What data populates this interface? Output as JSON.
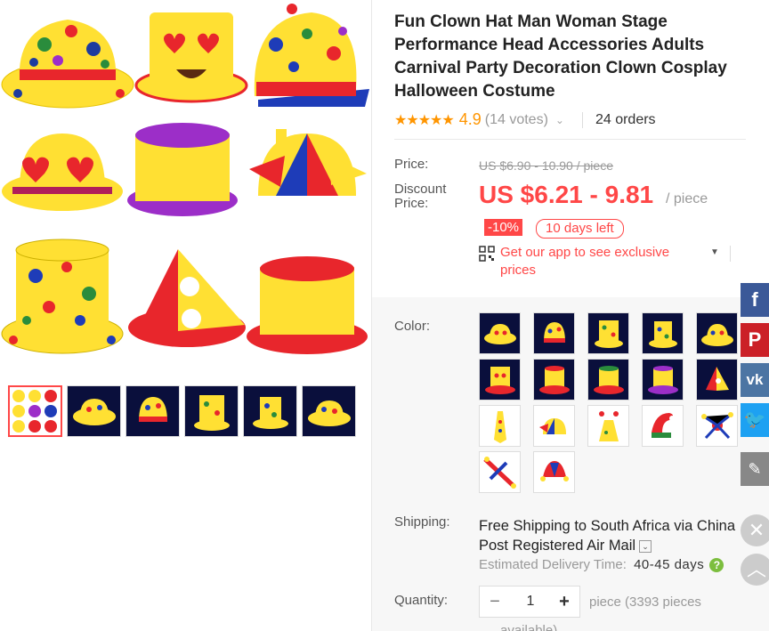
{
  "product": {
    "title": "Fun Clown Hat Man Woman Stage Performance Head Accessories Adults Carnival Party Decoration Clown Cosplay Halloween Costume",
    "rating": "4.9",
    "votes": "(14 votes)",
    "orders": "24 orders"
  },
  "price": {
    "label": "Price:",
    "old": "US $6.90 - 10.90 / piece",
    "discount_label": "Discount Price:",
    "current": "US $6.21 - 9.81",
    "unit": "/ piece",
    "discount_badge": "-10%",
    "days_left": "10 days left",
    "app_promo": "Get our app to see exclusive prices"
  },
  "color": {
    "label": "Color:",
    "swatch_count": 17
  },
  "shipping": {
    "label": "Shipping:",
    "free": "Free Shipping to",
    "country": "South Africa via China",
    "method": "Post Registered Air Mail",
    "delivery_label": "Estimated Delivery Time:",
    "delivery_value": "40-45 days"
  },
  "quantity": {
    "label": "Quantity:",
    "value": "1",
    "note": "piece (3393 pieces",
    "note_cut": "available)"
  },
  "colors": {
    "accent": "#ff4747",
    "star": "#ff9500",
    "facebook": "#3b5998",
    "pinterest": "#cb2027",
    "vk": "#4c75a3",
    "twitter": "#1da1f2"
  }
}
